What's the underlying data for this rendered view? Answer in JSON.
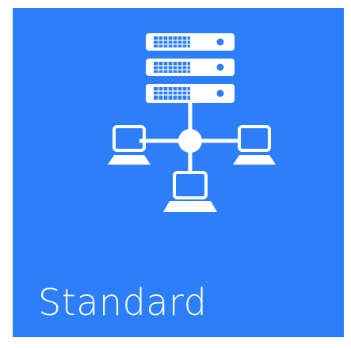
{
  "tile": {
    "label": "Standard",
    "icon": "network-server-icon",
    "background_color": "#2d7ff9",
    "foreground_color": "#ffffff"
  }
}
